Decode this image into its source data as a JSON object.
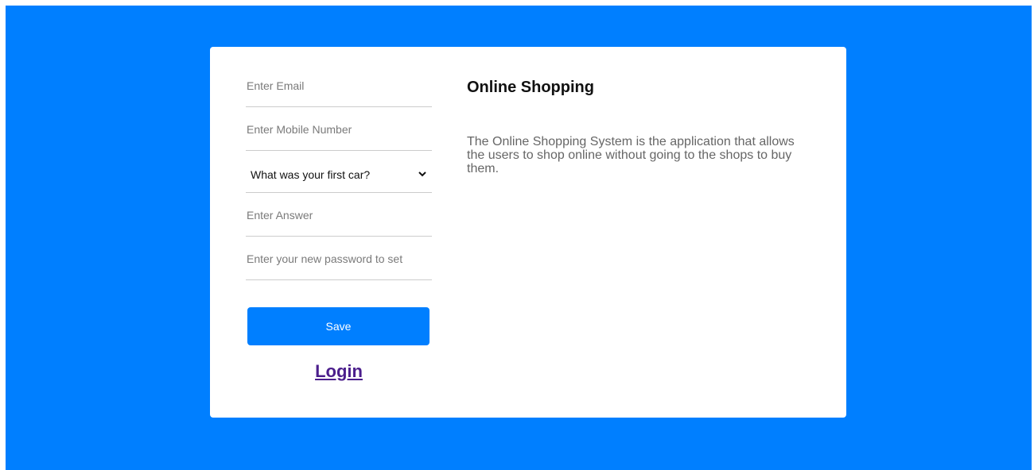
{
  "form": {
    "email_placeholder": "Enter Email",
    "mobile_placeholder": "Enter Mobile Number",
    "security_question_selected": "What was your first car?",
    "answer_placeholder": "Enter Answer",
    "password_placeholder": "Enter your new password to set",
    "save_label": "Save",
    "login_label": "Login"
  },
  "info": {
    "title": "Online Shopping",
    "description": "The Online Shopping System is the application that allows the users to shop online without going to the shops to buy them."
  },
  "colors": {
    "background": "#007fff",
    "button": "#007fff",
    "link": "#4b1e8c"
  }
}
